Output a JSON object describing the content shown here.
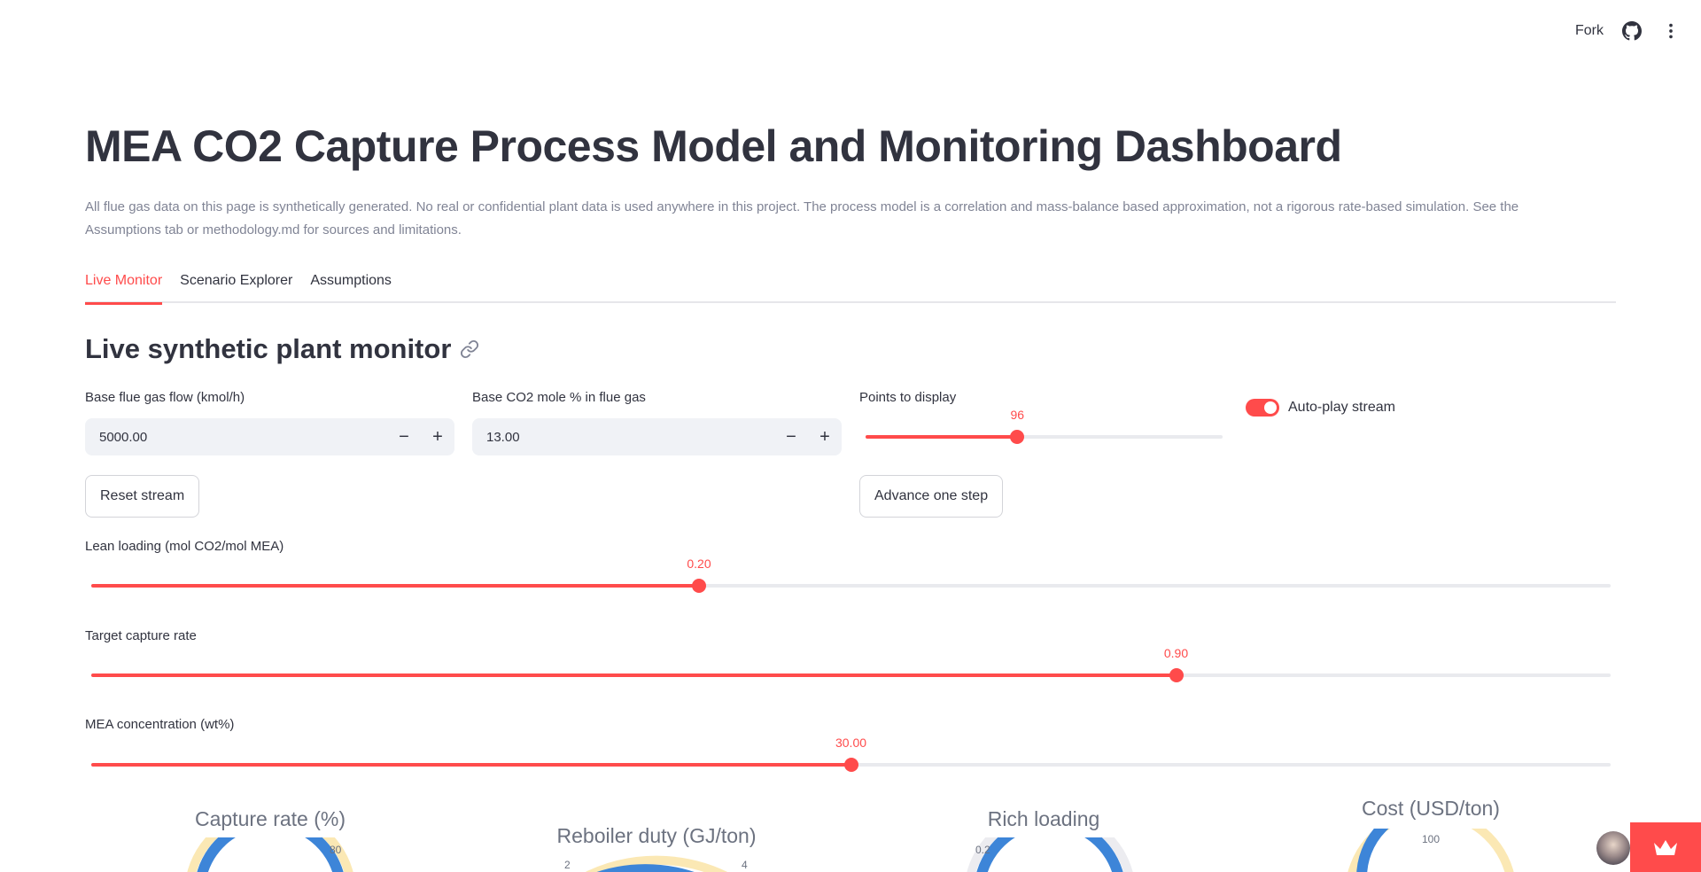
{
  "toolbar": {
    "fork_label": "Fork",
    "github_icon": "github-icon",
    "menu_icon": "more-vertical-icon"
  },
  "page": {
    "title": "MEA CO2 Capture Process Model and Monitoring Dashboard",
    "caption": "All flue gas data on this page is synthetically generated. No real or confidential plant data is used anywhere in this project. The process model is a correlation and mass-balance based approximation, not a rigorous rate-based simulation. See the Assumptions tab or methodology.md for sources and limitations."
  },
  "tabs": [
    {
      "label": "Live Monitor",
      "active": true
    },
    {
      "label": "Scenario Explorer",
      "active": false
    },
    {
      "label": "Assumptions",
      "active": false
    }
  ],
  "section": {
    "heading": "Live synthetic plant monitor",
    "link_icon": "link-icon"
  },
  "inputs": {
    "flue_flow": {
      "label": "Base flue gas flow (kmol/h)",
      "value": "5000.00",
      "minus": "−",
      "plus": "+"
    },
    "co2_mole": {
      "label": "Base CO2 mole % in flue gas",
      "value": "13.00",
      "minus": "−",
      "plus": "+"
    }
  },
  "sliders": {
    "points": {
      "label": "Points to display",
      "value": "96",
      "fraction": 0.425
    },
    "lean_loading": {
      "label": "Lean loading (mol CO2/mol MEA)",
      "value": "0.20",
      "fraction": 0.4
    },
    "capture_rate": {
      "label": "Target capture rate",
      "value": "0.90",
      "fraction": 0.714
    },
    "mea_conc": {
      "label": "MEA concentration (wt%)",
      "value": "30.00",
      "fraction": 0.5
    }
  },
  "toggle": {
    "label": "Auto-play stream",
    "on": true
  },
  "buttons": {
    "reset": "Reset stream",
    "advance": "Advance one step"
  },
  "gauges": [
    {
      "title": "Capture rate (%)",
      "tick": "80"
    },
    {
      "title": "Reboiler duty (GJ/ton)",
      "tick_left": "2",
      "tick_right": "4"
    },
    {
      "title": "Rich loading",
      "tick": "0.2"
    },
    {
      "title": "Cost (USD/ton)",
      "tick": "100"
    }
  ],
  "colors": {
    "accent": "#ff4b4b",
    "gauge_bar": "#3d85d8",
    "gauge_band": "#fbe8b4",
    "gauge_bg": "#ececf0"
  }
}
